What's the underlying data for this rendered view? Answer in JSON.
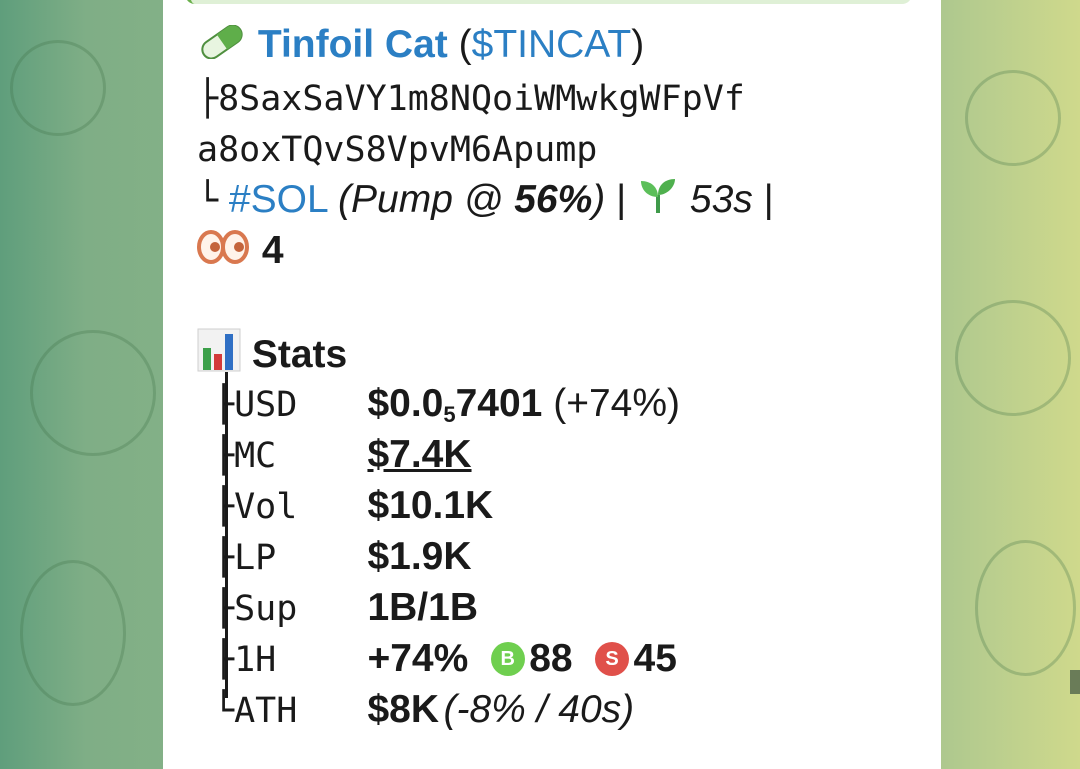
{
  "token": {
    "name": "Tinfoil Cat",
    "ticker_open": "(",
    "ticker": "$TINCAT",
    "ticker_close": ")",
    "address_line1": "8SaxSaVY1m8NQoiWMwkgWFpVf",
    "address_line2": "a8oxTQvS8VpvM6Apump",
    "chain_tag": "#SOL",
    "pump_prefix": "(Pump @ ",
    "pump_percent": "56%",
    "pump_suffix": ")",
    "sep1": "|",
    "age": "53s",
    "sep2": "|",
    "watchers": "4",
    "pill_icon": "pill-icon",
    "seedling_icon": "seedling-icon",
    "eyes_icon": "eyes-icon"
  },
  "stats": {
    "title": "Stats",
    "chart_icon": "bar-chart-icon",
    "usd": {
      "label": "USD",
      "main": "$0.0",
      "sub": "5",
      "rest": "7401",
      "change": " (+74%)"
    },
    "mc": {
      "label": "MC",
      "value": "$7.4K"
    },
    "vol": {
      "label": "Vol",
      "value": "$10.1K"
    },
    "lp": {
      "label": "LP",
      "value": "$1.9K"
    },
    "sup": {
      "label": "Sup",
      "value": "1B/1B"
    },
    "h1": {
      "label": "1H",
      "change": "+74%",
      "buy_badge": "B",
      "buys": "88",
      "sell_badge": "S",
      "sells": "45"
    },
    "ath": {
      "label": "ATH",
      "value": "$8K",
      "detail": "(-8% / 40s)"
    }
  },
  "colors": {
    "link": "#2b7fc4",
    "buy": "#6fcf4f",
    "sell": "#e0504a",
    "bubble": "#ffffff"
  }
}
